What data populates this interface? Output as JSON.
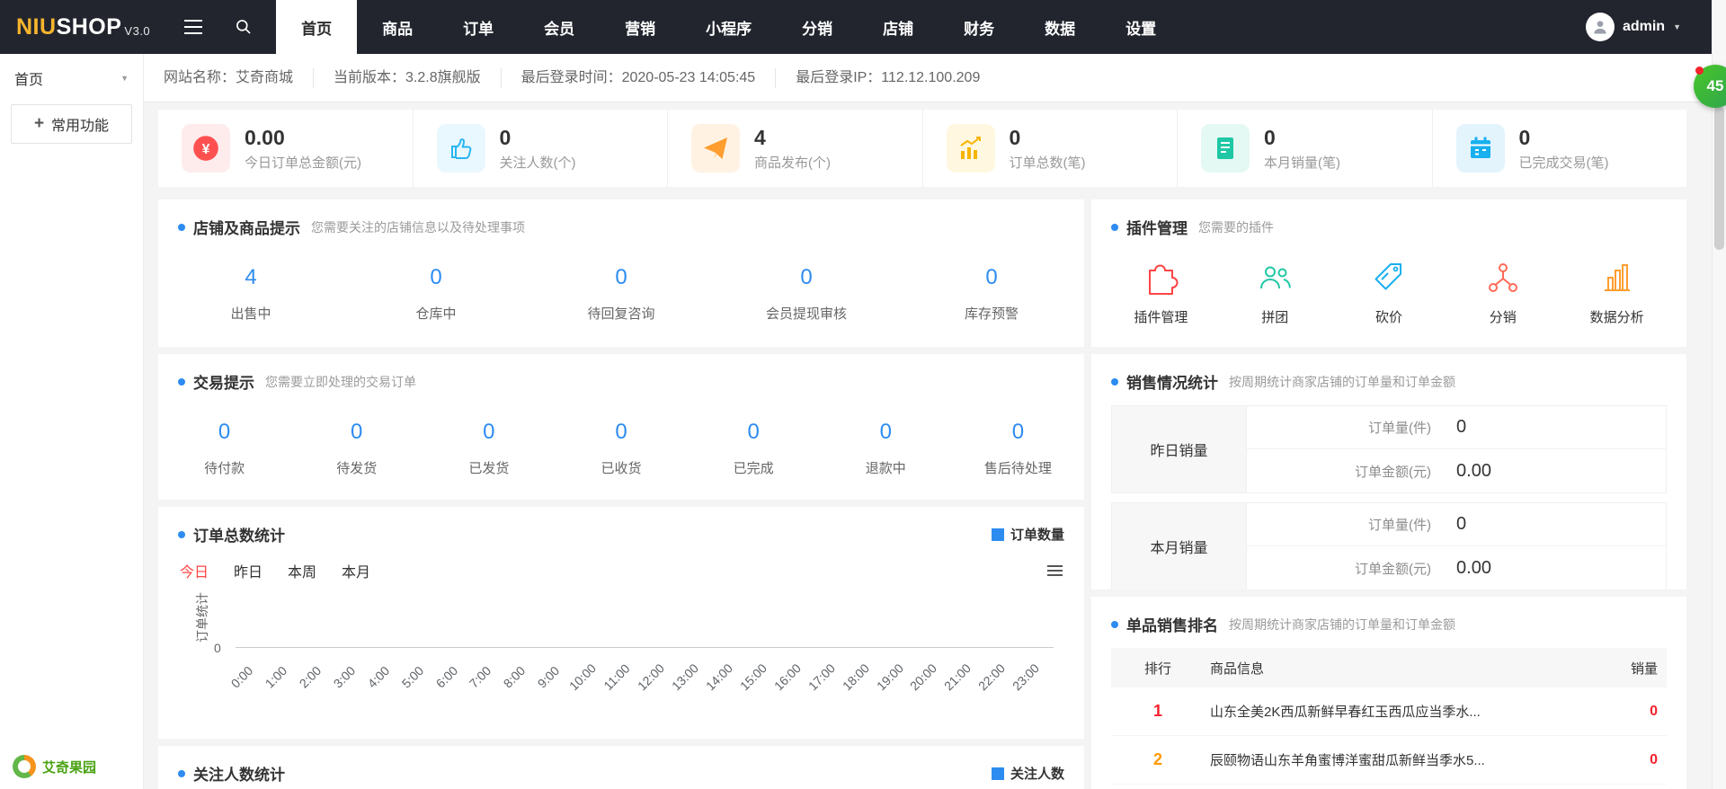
{
  "navbar": {
    "logo_niu": "NIU",
    "logo_shop": "SHOP",
    "logo_version": "V3.0",
    "items": [
      {
        "label": "首页",
        "active": true
      },
      {
        "label": "商品"
      },
      {
        "label": "订单"
      },
      {
        "label": "会员"
      },
      {
        "label": "营销"
      },
      {
        "label": "小程序"
      },
      {
        "label": "分销"
      },
      {
        "label": "店铺"
      },
      {
        "label": "财务"
      },
      {
        "label": "数据"
      },
      {
        "label": "设置"
      }
    ],
    "user": "admin"
  },
  "infobar": {
    "items": [
      "网站名称：艾奇商城",
      "当前版本：3.2.8旗舰版",
      "最后登录时间：2020-05-23 14:05:45",
      "最后登录IP：112.12.100.209"
    ]
  },
  "sidebar": {
    "current": "首页",
    "add_icon": "+",
    "add_button": "常用功能",
    "logo_text": "艾奇果园"
  },
  "stats": [
    {
      "value": "0.00",
      "label": "今日订单总金额(元)",
      "icon": "money-icon",
      "color": "#ff5050"
    },
    {
      "value": "0",
      "label": "关注人数(个)",
      "icon": "thumbs-up-icon",
      "color": "#29b6f2"
    },
    {
      "value": "4",
      "label": "商品发布(个)",
      "icon": "paper-plane-icon",
      "color": "#ff9d2e"
    },
    {
      "value": "0",
      "label": "订单总数(笔)",
      "icon": "bar-chart-icon",
      "color": "#f7b500"
    },
    {
      "value": "0",
      "label": "本月销量(笔)",
      "icon": "receipt-icon",
      "color": "#1fc7a5"
    },
    {
      "value": "0",
      "label": "已完成交易(笔)",
      "icon": "calendar-icon",
      "color": "#1ab0f0"
    }
  ],
  "panels": {
    "shop_tips": {
      "title": "店铺及商品提示",
      "subtitle": "您需要关注的店铺信息以及待处理事项",
      "items": [
        {
          "value": "4",
          "label": "出售中"
        },
        {
          "value": "0",
          "label": "仓库中"
        },
        {
          "value": "0",
          "label": "待回复咨询"
        },
        {
          "value": "0",
          "label": "会员提现审核"
        },
        {
          "value": "0",
          "label": "库存预警"
        }
      ]
    },
    "trade_tips": {
      "title": "交易提示",
      "subtitle": "您需要立即处理的交易订单",
      "items": [
        {
          "value": "0",
          "label": "待付款"
        },
        {
          "value": "0",
          "label": "待发货"
        },
        {
          "value": "0",
          "label": "已发货"
        },
        {
          "value": "0",
          "label": "已收货"
        },
        {
          "value": "0",
          "label": "已完成"
        },
        {
          "value": "0",
          "label": "退款中"
        },
        {
          "value": "0",
          "label": "售后待处理"
        }
      ]
    },
    "order_chart": {
      "title": "订单总数统计",
      "legend": "订单数量",
      "tabs": [
        "今日",
        "昨日",
        "本周",
        "本月"
      ],
      "active_tab": "今日",
      "ylabel": "订单统计",
      "ytick": "0",
      "chart_data": {
        "type": "line",
        "title": "订单总数统计",
        "xlabel": "",
        "ylabel": "订单统计",
        "legend_position": "top-right",
        "ylim": [
          0,
          1
        ],
        "grid": false,
        "x": [
          "0:00",
          "1:00",
          "2:00",
          "3:00",
          "4:00",
          "5:00",
          "6:00",
          "7:00",
          "8:00",
          "9:00",
          "10:00",
          "11:00",
          "12:00",
          "13:00",
          "14:00",
          "15:00",
          "16:00",
          "17:00",
          "18:00",
          "19:00",
          "20:00",
          "21:00",
          "22:00",
          "23:00"
        ],
        "series": [
          {
            "name": "订单数量",
            "values": [
              0,
              0,
              0,
              0,
              0,
              0,
              0,
              0,
              0,
              0,
              0,
              0,
              0,
              0,
              0,
              0,
              0,
              0,
              0,
              0,
              0,
              0,
              0,
              0
            ]
          }
        ]
      }
    },
    "follow_chart": {
      "title": "关注人数统计",
      "legend": "关注人数"
    },
    "plugins": {
      "title": "插件管理",
      "subtitle": "您需要的插件",
      "items": [
        {
          "label": "插件管理",
          "icon": "puzzle-icon",
          "color": "#ff4544"
        },
        {
          "label": "拼团",
          "icon": "group-icon",
          "color": "#1fc7a5"
        },
        {
          "label": "砍价",
          "icon": "price-tag-icon",
          "color": "#1ab0f0"
        },
        {
          "label": "分销",
          "icon": "share-network-icon",
          "color": "#ff6b57"
        },
        {
          "label": "数据分析",
          "icon": "analytics-icon",
          "color": "#ff9d2e"
        }
      ]
    },
    "sales_stats": {
      "title": "销售情况统计",
      "subtitle": "按周期统计商家店铺的订单量和订单金额",
      "groups": [
        {
          "period": "昨日销量",
          "metrics": [
            {
              "label": "订单量(件)",
              "value": "0"
            },
            {
              "label": "订单金额(元)",
              "value": "0.00"
            }
          ]
        },
        {
          "period": "本月销量",
          "metrics": [
            {
              "label": "订单量(件)",
              "value": "0"
            },
            {
              "label": "订单金额(元)",
              "value": "0.00"
            }
          ]
        }
      ]
    },
    "ranking": {
      "title": "单品销售排名",
      "subtitle": "按周期统计商家店铺的订单量和订单金额",
      "headers": [
        "排行",
        "商品信息",
        "销量"
      ],
      "rows": [
        {
          "rank": "1",
          "name": "山东全美2K西瓜新鲜早春红玉西瓜应当季水...",
          "sales": "0"
        },
        {
          "rank": "2",
          "name": "辰颐物语山东羊角蜜博洋蜜甜瓜新鲜当季水5...",
          "sales": "0"
        }
      ]
    }
  },
  "float_badge": {
    "count": "45"
  },
  "colors": {
    "navbar_bg": "#22252e",
    "accent_blue": "#2d8cf0",
    "danger_red": "#f5222d",
    "warn_orange": "#ff9900",
    "logo_yellow": "#f7b52c"
  }
}
